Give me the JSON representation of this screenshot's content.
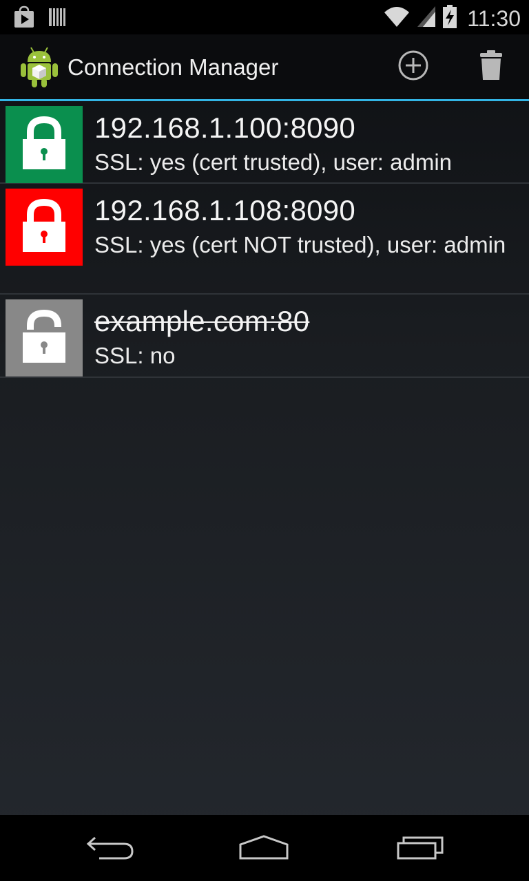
{
  "status_bar": {
    "time": "11:30",
    "icons": [
      "play-store-icon",
      "barcode-icon",
      "wifi-icon",
      "signal-icon",
      "battery-charging-icon"
    ]
  },
  "action_bar": {
    "title": "Connection Manager",
    "app_icon": "android-app-icon",
    "actions": [
      "add-icon",
      "trash-icon"
    ],
    "accent_color": "#33b5e5"
  },
  "connections": [
    {
      "title": "192.168.1.100:8090",
      "subtitle": "SSL: yes (cert trusted), user: admin",
      "status": "trusted",
      "tile_color": "#0a8f4e",
      "lock_state": "locked"
    },
    {
      "title": "192.168.1.108:8090",
      "subtitle": "SSL: yes (cert NOT trusted), user: admin",
      "status": "untrusted",
      "tile_color": "#ff0000",
      "lock_state": "locked"
    },
    {
      "title": "example.com:80",
      "subtitle": "SSL: no",
      "status": "disabled",
      "tile_color": "#888888",
      "lock_state": "unlocked"
    }
  ],
  "nav_bar": {
    "buttons": [
      "back-icon",
      "home-icon",
      "recents-icon"
    ]
  }
}
